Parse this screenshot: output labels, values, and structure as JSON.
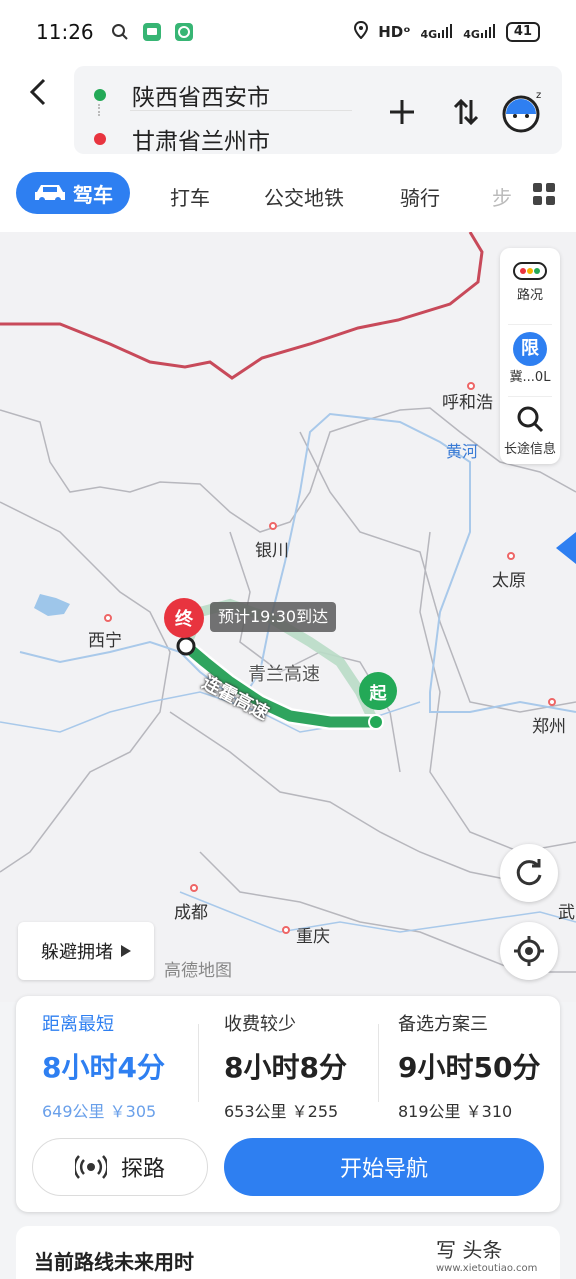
{
  "status_bar": {
    "time": "11:26",
    "network": "HDᵒ",
    "signal1": "4G",
    "signal2": "4G",
    "battery": "41"
  },
  "route": {
    "origin": "陕西省西安市",
    "destination": "甘肃省兰州市"
  },
  "modes": {
    "active": "驾车",
    "taxi": "打车",
    "transit": "公交地铁",
    "bike": "骑行",
    "walk": "步"
  },
  "map": {
    "cities": {
      "huhehaote": "呼和浩",
      "yinchuan": "银川",
      "taiyuan": "太原",
      "xining": "西宁",
      "zhengzhou": "郑州",
      "chengdu": "成都",
      "chongqing": "重庆",
      "wu": "武"
    },
    "river": "黄河",
    "eta": "预计19:30到达",
    "route_main": "连霍高速",
    "route_alt": "青兰高速",
    "end_pin": "终",
    "start_pin": "起",
    "side": {
      "traffic": "路况",
      "limit_icon": "限",
      "limit": "冀...0L",
      "long_trip": "长途信息"
    },
    "avoid": "躲避拥堵",
    "logo": "高德地图"
  },
  "options": [
    {
      "label": "距离最短",
      "duration": "8小时4分",
      "distance": "649公里",
      "toll": "￥305"
    },
    {
      "label": "收费较少",
      "duration": "8小时8分",
      "distance": "653公里",
      "toll": "￥255"
    },
    {
      "label": "备选方案三",
      "duration": "9小时50分",
      "distance": "819公里",
      "toll": "￥310"
    }
  ],
  "actions": {
    "probe": "探路",
    "start": "开始导航"
  },
  "bottom": {
    "title": "当前路线未来用时"
  },
  "watermark": {
    "main": "写 头条",
    "sub": "www.xietoutiao.com"
  },
  "colors": {
    "accent": "#2e7ff1",
    "route": "#2fa45e",
    "end": "#e8343f",
    "start": "#23a957"
  }
}
